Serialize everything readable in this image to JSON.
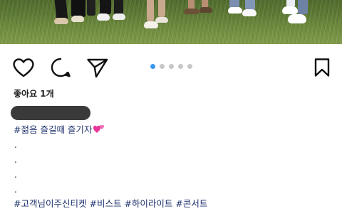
{
  "post": {
    "likes_text": "좋아요 1개",
    "caption_first": "#젊음 즐길때 즐기자",
    "caption_emoji": "two-hearts-emoji",
    "dot_lines": [
      ".",
      ".",
      ".",
      "."
    ],
    "hashtags": [
      "#고객님이주신티켓",
      "#비스트",
      "#하이라이트",
      "#콘서트"
    ],
    "carousel": {
      "count": 5,
      "active_index": 0
    }
  },
  "colors": {
    "hashtag": "#1b2f6b",
    "dot_active": "#3897f0",
    "dot_inactive": "#c7c7c7",
    "heart": "#e8369a"
  },
  "icons": {
    "like": "heart-outline-icon",
    "comment": "comment-bubble-icon",
    "share": "paper-plane-icon",
    "save": "bookmark-icon"
  }
}
